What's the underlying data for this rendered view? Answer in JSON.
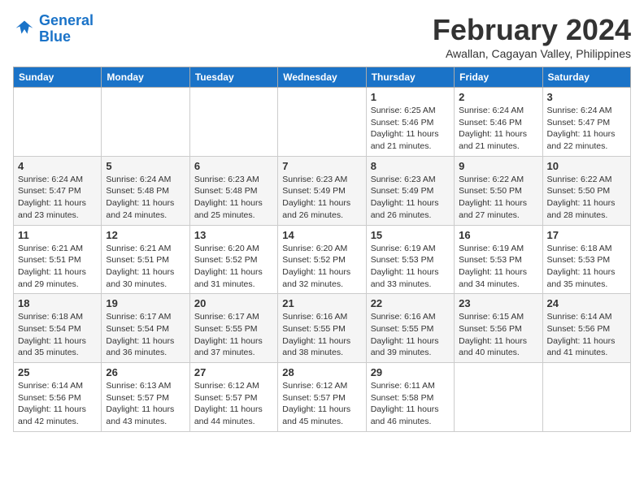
{
  "logo": {
    "line1": "General",
    "line2": "Blue"
  },
  "title": "February 2024",
  "subtitle": "Awallan, Cagayan Valley, Philippines",
  "days_header": [
    "Sunday",
    "Monday",
    "Tuesday",
    "Wednesday",
    "Thursday",
    "Friday",
    "Saturday"
  ],
  "weeks": [
    [
      {
        "day": "",
        "info": ""
      },
      {
        "day": "",
        "info": ""
      },
      {
        "day": "",
        "info": ""
      },
      {
        "day": "",
        "info": ""
      },
      {
        "day": "1",
        "info": "Sunrise: 6:25 AM\nSunset: 5:46 PM\nDaylight: 11 hours\nand 21 minutes."
      },
      {
        "day": "2",
        "info": "Sunrise: 6:24 AM\nSunset: 5:46 PM\nDaylight: 11 hours\nand 21 minutes."
      },
      {
        "day": "3",
        "info": "Sunrise: 6:24 AM\nSunset: 5:47 PM\nDaylight: 11 hours\nand 22 minutes."
      }
    ],
    [
      {
        "day": "4",
        "info": "Sunrise: 6:24 AM\nSunset: 5:47 PM\nDaylight: 11 hours\nand 23 minutes."
      },
      {
        "day": "5",
        "info": "Sunrise: 6:24 AM\nSunset: 5:48 PM\nDaylight: 11 hours\nand 24 minutes."
      },
      {
        "day": "6",
        "info": "Sunrise: 6:23 AM\nSunset: 5:48 PM\nDaylight: 11 hours\nand 25 minutes."
      },
      {
        "day": "7",
        "info": "Sunrise: 6:23 AM\nSunset: 5:49 PM\nDaylight: 11 hours\nand 26 minutes."
      },
      {
        "day": "8",
        "info": "Sunrise: 6:23 AM\nSunset: 5:49 PM\nDaylight: 11 hours\nand 26 minutes."
      },
      {
        "day": "9",
        "info": "Sunrise: 6:22 AM\nSunset: 5:50 PM\nDaylight: 11 hours\nand 27 minutes."
      },
      {
        "day": "10",
        "info": "Sunrise: 6:22 AM\nSunset: 5:50 PM\nDaylight: 11 hours\nand 28 minutes."
      }
    ],
    [
      {
        "day": "11",
        "info": "Sunrise: 6:21 AM\nSunset: 5:51 PM\nDaylight: 11 hours\nand 29 minutes."
      },
      {
        "day": "12",
        "info": "Sunrise: 6:21 AM\nSunset: 5:51 PM\nDaylight: 11 hours\nand 30 minutes."
      },
      {
        "day": "13",
        "info": "Sunrise: 6:20 AM\nSunset: 5:52 PM\nDaylight: 11 hours\nand 31 minutes."
      },
      {
        "day": "14",
        "info": "Sunrise: 6:20 AM\nSunset: 5:52 PM\nDaylight: 11 hours\nand 32 minutes."
      },
      {
        "day": "15",
        "info": "Sunrise: 6:19 AM\nSunset: 5:53 PM\nDaylight: 11 hours\nand 33 minutes."
      },
      {
        "day": "16",
        "info": "Sunrise: 6:19 AM\nSunset: 5:53 PM\nDaylight: 11 hours\nand 34 minutes."
      },
      {
        "day": "17",
        "info": "Sunrise: 6:18 AM\nSunset: 5:53 PM\nDaylight: 11 hours\nand 35 minutes."
      }
    ],
    [
      {
        "day": "18",
        "info": "Sunrise: 6:18 AM\nSunset: 5:54 PM\nDaylight: 11 hours\nand 35 minutes."
      },
      {
        "day": "19",
        "info": "Sunrise: 6:17 AM\nSunset: 5:54 PM\nDaylight: 11 hours\nand 36 minutes."
      },
      {
        "day": "20",
        "info": "Sunrise: 6:17 AM\nSunset: 5:55 PM\nDaylight: 11 hours\nand 37 minutes."
      },
      {
        "day": "21",
        "info": "Sunrise: 6:16 AM\nSunset: 5:55 PM\nDaylight: 11 hours\nand 38 minutes."
      },
      {
        "day": "22",
        "info": "Sunrise: 6:16 AM\nSunset: 5:55 PM\nDaylight: 11 hours\nand 39 minutes."
      },
      {
        "day": "23",
        "info": "Sunrise: 6:15 AM\nSunset: 5:56 PM\nDaylight: 11 hours\nand 40 minutes."
      },
      {
        "day": "24",
        "info": "Sunrise: 6:14 AM\nSunset: 5:56 PM\nDaylight: 11 hours\nand 41 minutes."
      }
    ],
    [
      {
        "day": "25",
        "info": "Sunrise: 6:14 AM\nSunset: 5:56 PM\nDaylight: 11 hours\nand 42 minutes."
      },
      {
        "day": "26",
        "info": "Sunrise: 6:13 AM\nSunset: 5:57 PM\nDaylight: 11 hours\nand 43 minutes."
      },
      {
        "day": "27",
        "info": "Sunrise: 6:12 AM\nSunset: 5:57 PM\nDaylight: 11 hours\nand 44 minutes."
      },
      {
        "day": "28",
        "info": "Sunrise: 6:12 AM\nSunset: 5:57 PM\nDaylight: 11 hours\nand 45 minutes."
      },
      {
        "day": "29",
        "info": "Sunrise: 6:11 AM\nSunset: 5:58 PM\nDaylight: 11 hours\nand 46 minutes."
      },
      {
        "day": "",
        "info": ""
      },
      {
        "day": "",
        "info": ""
      }
    ]
  ]
}
